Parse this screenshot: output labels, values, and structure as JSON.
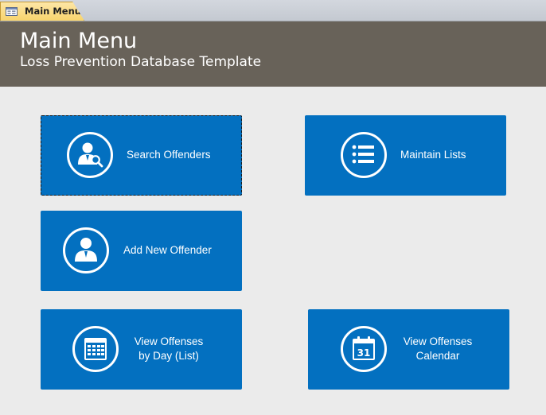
{
  "tab": {
    "label": "Main Menu"
  },
  "header": {
    "title": "Main Menu",
    "subtitle": "Loss Prevention Database Template"
  },
  "tiles": {
    "search": {
      "label": "Search Offenders"
    },
    "lists": {
      "label": "Maintain Lists"
    },
    "add": {
      "label": "Add New Offender"
    },
    "day": {
      "line1": "View Offenses",
      "line2": "by Day (List)"
    },
    "calendar": {
      "line1": "View Offenses",
      "line2": "Calendar"
    }
  },
  "colors": {
    "header_bg": "#686259",
    "tile_bg": "#0370c0",
    "page_bg": "#ebebeb",
    "tab_bg": "#f8d46c"
  },
  "icons": {
    "tab": "form-icon",
    "search": "person-search-icon",
    "lists": "list-icon",
    "add": "person-icon",
    "day": "calendar-grid-icon",
    "calendar": "calendar-31-icon"
  }
}
